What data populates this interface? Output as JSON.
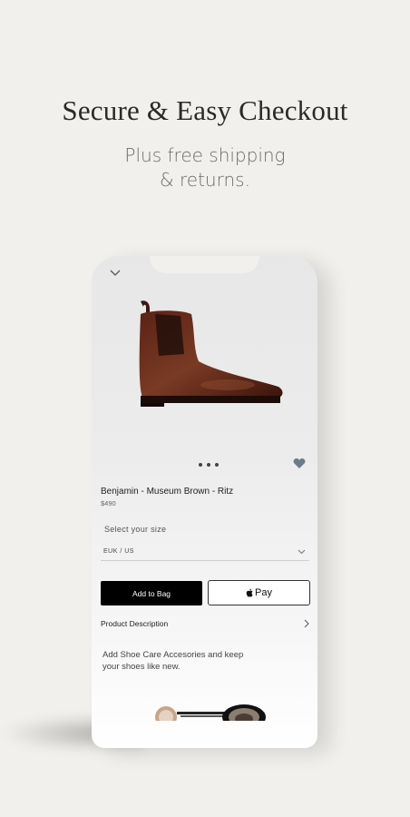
{
  "promo": {
    "headline": "Secure & Easy Checkout",
    "subline_1": "Plus free shipping",
    "subline_2": "& returns."
  },
  "product": {
    "name": "Benjamin - Museum Brown - Ritz",
    "price": "$490",
    "image_icon": "chelsea-boot"
  },
  "size": {
    "label": "Select your size",
    "selected": "EUK / US"
  },
  "actions": {
    "add_to_bag": "Add to Bag",
    "apple_pay": "Pay",
    "apple_pay_icon": "apple-logo"
  },
  "description": {
    "label": "Product Description"
  },
  "care": {
    "text": "Add Shoe Care Accesories and keep your shoes like new."
  },
  "colors": {
    "background": "#f1f0ec",
    "heart": "#6b7b8c",
    "button_dark": "#000000"
  }
}
